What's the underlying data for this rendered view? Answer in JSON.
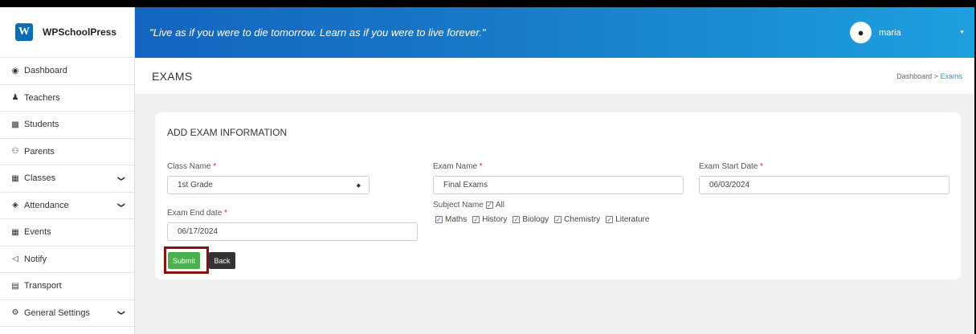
{
  "brand": {
    "name": "WPSchoolPress",
    "logo_letter": "W"
  },
  "header": {
    "quote": "\"Live as if you were to die tomorrow. Learn as if you were to live forever.\"",
    "username": "maria"
  },
  "sidebar": {
    "items": [
      {
        "label": "Dashboard",
        "icon": "dashboard-icon"
      },
      {
        "label": "Teachers",
        "icon": "teacher-icon"
      },
      {
        "label": "Students",
        "icon": "student-icon"
      },
      {
        "label": "Parents",
        "icon": "parents-icon"
      },
      {
        "label": "Classes",
        "icon": "classes-icon",
        "has_submenu": true
      },
      {
        "label": "Attendance",
        "icon": "attendance-icon",
        "has_submenu": true
      },
      {
        "label": "Events",
        "icon": "calendar-icon"
      },
      {
        "label": "Notify",
        "icon": "notify-icon"
      },
      {
        "label": "Transport",
        "icon": "bus-icon"
      },
      {
        "label": "General Settings",
        "icon": "gear-icon",
        "has_submenu": true
      }
    ]
  },
  "page": {
    "title": "EXAMS",
    "breadcrumb": {
      "parent": "Dashboard",
      "separator": ">",
      "current": "Exams"
    }
  },
  "form": {
    "heading": "ADD EXAM INFORMATION",
    "class_name": {
      "label": "Class Name",
      "value": "1st Grade"
    },
    "exam_name": {
      "label": "Exam Name",
      "value": "Final Exams"
    },
    "exam_start_date": {
      "label": "Exam Start Date",
      "value": "06/03/2024"
    },
    "exam_end_date": {
      "label": "Exam End date",
      "value": "06/17/2024"
    },
    "subject_name": {
      "label": "Subject Name",
      "all_label": "All",
      "all_checked": true,
      "subjects": [
        {
          "label": "Maths",
          "checked": true
        },
        {
          "label": "History",
          "checked": true
        },
        {
          "label": "Biology",
          "checked": true
        },
        {
          "label": "Chemistry",
          "checked": true
        },
        {
          "label": "Literature",
          "checked": true
        }
      ]
    },
    "required_mark": "*",
    "submit_label": "Submit",
    "back_label": "Back"
  },
  "colors": {
    "header_gradient_start": "#1565c0",
    "header_gradient_end": "#1da0e0",
    "submit": "#4caf50",
    "back": "#333333",
    "highlight_border": "#8a1010",
    "breadcrumb_active": "#1e9bd7"
  }
}
